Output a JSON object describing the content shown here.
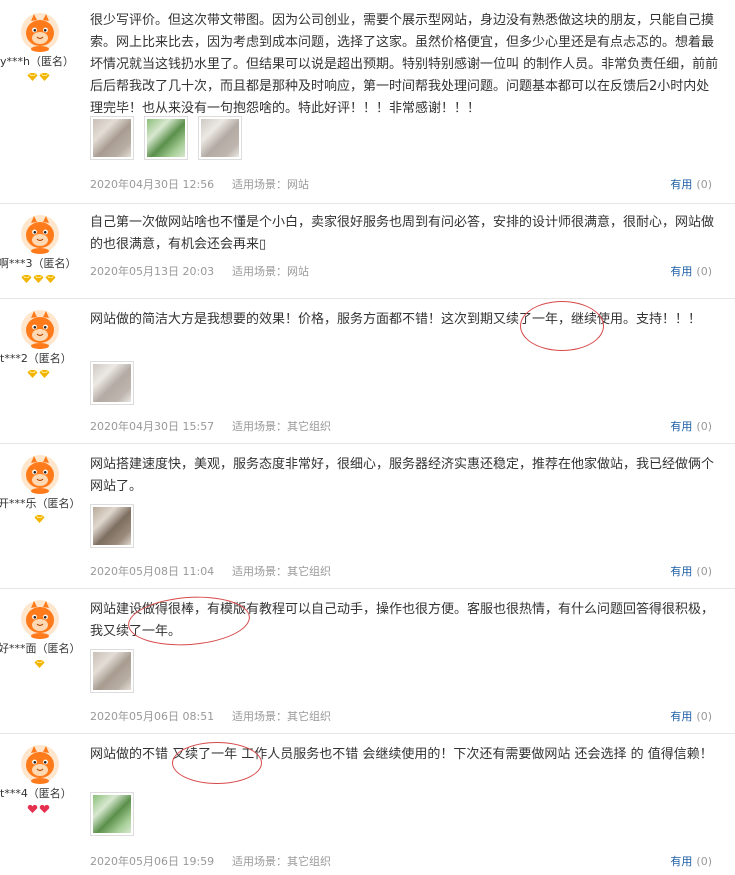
{
  "reviews": [
    {
      "user": "y***h（匿名）",
      "rank": "diamond",
      "rank_count": 2,
      "text": "很少写评价。但这次带文带图。因为公司创业，需要个展示型网站，身边没有熟悉做这块的朋友，只能自己摸索。网上比来比去，因为考虑到成本问题，选择了这家。虽然价格便宜，但多少心里还是有点忐忑的。想着最坏情况就当这钱扔水里了。但结果可以说是超出预期。特别特别感谢一位叫 的制作人员。非常负责任细，前前后后帮我改了几十次，而且都是那种及时响应，第一时间帮我处理问题。问题基本都可以在反馈后2小时内处理完毕！也从来没有一句抱怨啥的。特此好评！！！非常感谢！！！",
      "photos": 3,
      "date": "2020年04月30日 12:56",
      "scene": "适用场景：网站",
      "useful_label": "有用",
      "useful_count": "(0)"
    },
    {
      "user": "啊***3（匿名）",
      "rank": "diamond",
      "rank_count": 3,
      "text": "自己第一次做网站啥也不懂是个小白，卖家很好服务也周到有问必答，安排的设计师很满意，很耐心，网站做的也很满意，有机会还会再来▯",
      "photos": 0,
      "date": "2020年05月13日 20:03",
      "scene": "适用场景：网站",
      "useful_label": "有用",
      "useful_count": "(0)"
    },
    {
      "user": "t***2（匿名）",
      "rank": "diamond",
      "rank_count": 2,
      "text": "网站做的简洁大方是我想要的效果！价格，服务方面都不错！这次到期又续了一年，继续使用。支持！！！",
      "photos": 1,
      "date": "2020年04月30日 15:57",
      "scene": "适用场景：其它组织",
      "useful_label": "有用",
      "useful_count": "(0)"
    },
    {
      "user": "开***乐（匿名）",
      "rank": "diamond",
      "rank_count": 1,
      "text": "网站搭建速度快，美观，服务态度非常好，很细心，服务器经济实惠还稳定，推荐在他家做站，我已经做俩个网站了。",
      "photos": 1,
      "date": "2020年05月08日 11:04",
      "scene": "适用场景：其它组织",
      "useful_label": "有用",
      "useful_count": "(0)"
    },
    {
      "user": "好***面（匿名）",
      "rank": "diamond",
      "rank_count": 1,
      "text": "网站建设做得很棒，有模版有教程可以自己动手，操作也很方便。客服也很热情，有什么问题回答得很积极，我又续了一年。",
      "photos": 1,
      "date": "2020年05月06日 08:51",
      "scene": "适用场景：其它组织",
      "useful_label": "有用",
      "useful_count": "(0)"
    },
    {
      "user": "t***4（匿名）",
      "rank": "heart",
      "rank_count": 2,
      "text": "网站做的不错 又续了一年 工作人员服务也不错 会继续使用的！下次还有需要做网站 还会选择 的 值得信赖！",
      "photos": 1,
      "date": "2020年05月06日 19:59",
      "scene": "适用场景：其它组织",
      "useful_label": "有用",
      "useful_count": "(0)"
    }
  ],
  "colors": {
    "link": "#1f5fa6",
    "meta": "#999999",
    "divider": "#e6e6e6",
    "highlight_circle": "#d84a4a",
    "avatar_orange": "#ff7a1a",
    "rank_diamond": "#f2b400",
    "rank_heart": "#e5304f"
  },
  "icons": {
    "avatar": "orange-mascot-avatar",
    "diamond": "diamond-rank-icon",
    "heart": "heart-rank-icon"
  }
}
